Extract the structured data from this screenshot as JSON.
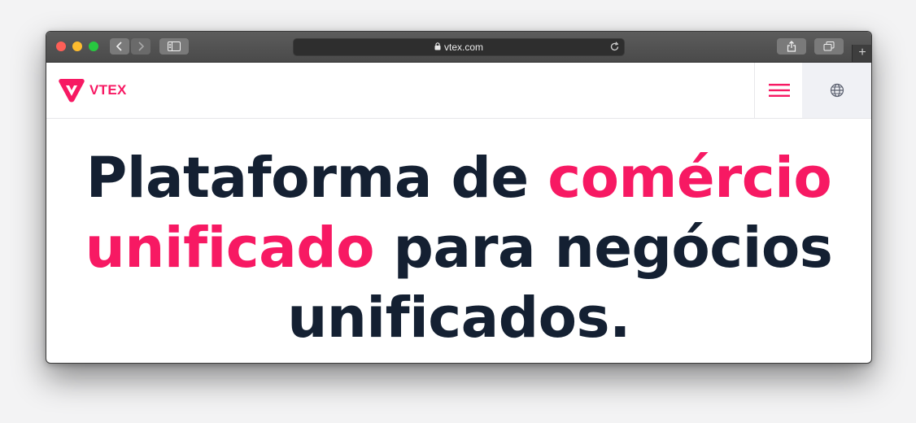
{
  "browser": {
    "url": "vtex.com",
    "new_tab_label": "+"
  },
  "site": {
    "logo_text": "VTEX",
    "colors": {
      "brand": "#f71963",
      "heading": "#142032"
    },
    "header": {
      "menu_icon": "hamburger-icon",
      "language_icon": "globe-icon"
    },
    "hero": {
      "part1": "Plataforma de ",
      "highlight1": "comércio",
      "highlight2": "unificado",
      "part2": " para negócios",
      "part3": "unificados."
    }
  }
}
